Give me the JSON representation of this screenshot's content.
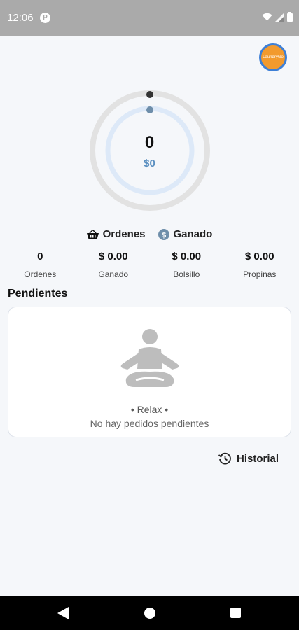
{
  "status_bar": {
    "time": "12:06",
    "app_badge": "P",
    "icons": [
      "wifi-icon",
      "signal-icon",
      "battery-icon"
    ]
  },
  "header": {
    "avatar_text": "LaundryGo",
    "avatar_colors": {
      "fill": "#f29a2e",
      "border": "#3d7fd6"
    }
  },
  "summary_ring": {
    "orders_count": "0",
    "earned": "$0",
    "colors": {
      "outer": "#e2e2e2",
      "inner": "#dde9f8",
      "outer_dot": "#333333",
      "inner_dot": "#6e8eaa"
    }
  },
  "legend": [
    {
      "icon": "basket-icon",
      "label": "Ordenes"
    },
    {
      "icon": "dollar-coin-icon",
      "label": "Ganado"
    }
  ],
  "stats": [
    {
      "value": "0",
      "label": "Ordenes"
    },
    {
      "value": "$ 0.00",
      "label": "Ganado"
    },
    {
      "value": "$ 0.00",
      "label": "Bolsillo"
    },
    {
      "value": "$ 0.00",
      "label": "Propinas"
    }
  ],
  "pending": {
    "title": "Pendientes",
    "empty_title": "• Relax •",
    "empty_subtitle": "No hay pedidos pendientes",
    "illustration_icon": "meditation-icon"
  },
  "history": {
    "label": "Historial",
    "icon": "history-icon"
  },
  "nav_bar": {
    "icons": [
      "back-icon",
      "home-icon",
      "recent-apps-icon"
    ]
  }
}
